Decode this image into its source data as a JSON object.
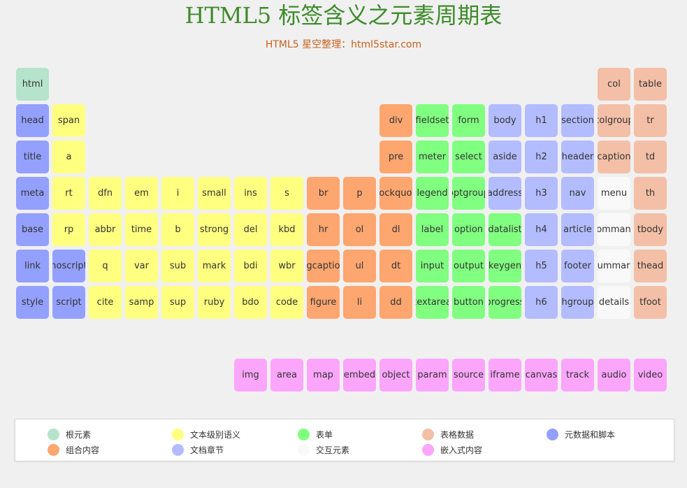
{
  "page": {
    "title": "HTML5 标签含义之元素周期表",
    "subtitle": "HTML5 星空整理：html5star.com"
  },
  "colors": {
    "root": "#b5e3cc",
    "text": "#ffff80",
    "form": "#80ff80",
    "table": "#f3bfa6",
    "meta": "#93a0fd",
    "group": "#fda670",
    "section": "#b3bcfe",
    "interactive": "#f9f9f9",
    "embedded": "#fba5fb"
  },
  "elements": [
    {
      "label": "html",
      "cat": "root",
      "col": 0,
      "row": 0
    },
    {
      "label": "col",
      "cat": "table",
      "col": 16,
      "row": 0
    },
    {
      "label": "table",
      "cat": "table",
      "col": 17,
      "row": 0
    },
    {
      "label": "head",
      "cat": "meta",
      "col": 0,
      "row": 1
    },
    {
      "label": "span",
      "cat": "text",
      "col": 1,
      "row": 1
    },
    {
      "label": "div",
      "cat": "group",
      "col": 10,
      "row": 1
    },
    {
      "label": "fieldset",
      "cat": "form",
      "col": 11,
      "row": 1
    },
    {
      "label": "form",
      "cat": "form",
      "col": 12,
      "row": 1
    },
    {
      "label": "body",
      "cat": "section",
      "col": 13,
      "row": 1
    },
    {
      "label": "h1",
      "cat": "section",
      "col": 14,
      "row": 1
    },
    {
      "label": "section",
      "cat": "section",
      "col": 15,
      "row": 1
    },
    {
      "label": "colgroup",
      "cat": "table",
      "col": 16,
      "row": 1
    },
    {
      "label": "tr",
      "cat": "table",
      "col": 17,
      "row": 1
    },
    {
      "label": "title",
      "cat": "meta",
      "col": 0,
      "row": 2
    },
    {
      "label": "a",
      "cat": "text",
      "col": 1,
      "row": 2
    },
    {
      "label": "pre",
      "cat": "group",
      "col": 10,
      "row": 2
    },
    {
      "label": "meter",
      "cat": "form",
      "col": 11,
      "row": 2
    },
    {
      "label": "select",
      "cat": "form",
      "col": 12,
      "row": 2
    },
    {
      "label": "aside",
      "cat": "section",
      "col": 13,
      "row": 2
    },
    {
      "label": "h2",
      "cat": "section",
      "col": 14,
      "row": 2
    },
    {
      "label": "header",
      "cat": "section",
      "col": 15,
      "row": 2
    },
    {
      "label": "caption",
      "cat": "table",
      "col": 16,
      "row": 2
    },
    {
      "label": "td",
      "cat": "table",
      "col": 17,
      "row": 2
    },
    {
      "label": "meta",
      "cat": "meta",
      "col": 0,
      "row": 3
    },
    {
      "label": "rt",
      "cat": "text",
      "col": 1,
      "row": 3
    },
    {
      "label": "dfn",
      "cat": "text",
      "col": 2,
      "row": 3
    },
    {
      "label": "em",
      "cat": "text",
      "col": 3,
      "row": 3
    },
    {
      "label": "i",
      "cat": "text",
      "col": 4,
      "row": 3
    },
    {
      "label": "small",
      "cat": "text",
      "col": 5,
      "row": 3
    },
    {
      "label": "ins",
      "cat": "text",
      "col": 6,
      "row": 3
    },
    {
      "label": "s",
      "cat": "text",
      "col": 7,
      "row": 3
    },
    {
      "label": "br",
      "cat": "group",
      "col": 8,
      "row": 3
    },
    {
      "label": "p",
      "cat": "group",
      "col": 9,
      "row": 3
    },
    {
      "label": "blockquote",
      "cat": "group",
      "col": 10,
      "row": 3
    },
    {
      "label": "legend",
      "cat": "form",
      "col": 11,
      "row": 3
    },
    {
      "label": "optgroup",
      "cat": "form",
      "col": 12,
      "row": 3
    },
    {
      "label": "address",
      "cat": "section",
      "col": 13,
      "row": 3
    },
    {
      "label": "h3",
      "cat": "section",
      "col": 14,
      "row": 3
    },
    {
      "label": "nav",
      "cat": "section",
      "col": 15,
      "row": 3
    },
    {
      "label": "menu",
      "cat": "interactive",
      "col": 16,
      "row": 3
    },
    {
      "label": "th",
      "cat": "table",
      "col": 17,
      "row": 3
    },
    {
      "label": "base",
      "cat": "meta",
      "col": 0,
      "row": 4
    },
    {
      "label": "rp",
      "cat": "text",
      "col": 1,
      "row": 4
    },
    {
      "label": "abbr",
      "cat": "text",
      "col": 2,
      "row": 4
    },
    {
      "label": "time",
      "cat": "text",
      "col": 3,
      "row": 4
    },
    {
      "label": "b",
      "cat": "text",
      "col": 4,
      "row": 4
    },
    {
      "label": "strong",
      "cat": "text",
      "col": 5,
      "row": 4
    },
    {
      "label": "del",
      "cat": "text",
      "col": 6,
      "row": 4
    },
    {
      "label": "kbd",
      "cat": "text",
      "col": 7,
      "row": 4
    },
    {
      "label": "hr",
      "cat": "group",
      "col": 8,
      "row": 4
    },
    {
      "label": "ol",
      "cat": "group",
      "col": 9,
      "row": 4
    },
    {
      "label": "dl",
      "cat": "group",
      "col": 10,
      "row": 4
    },
    {
      "label": "label",
      "cat": "form",
      "col": 11,
      "row": 4
    },
    {
      "label": "option",
      "cat": "form",
      "col": 12,
      "row": 4
    },
    {
      "label": "datalist",
      "cat": "form",
      "col": 13,
      "row": 4
    },
    {
      "label": "h4",
      "cat": "section",
      "col": 14,
      "row": 4
    },
    {
      "label": "article",
      "cat": "section",
      "col": 15,
      "row": 4
    },
    {
      "label": "command",
      "cat": "interactive",
      "col": 16,
      "row": 4
    },
    {
      "label": "tbody",
      "cat": "table",
      "col": 17,
      "row": 4
    },
    {
      "label": "link",
      "cat": "meta",
      "col": 0,
      "row": 5
    },
    {
      "label": "noscript",
      "cat": "meta",
      "col": 1,
      "row": 5
    },
    {
      "label": "q",
      "cat": "text",
      "col": 2,
      "row": 5
    },
    {
      "label": "var",
      "cat": "text",
      "col": 3,
      "row": 5
    },
    {
      "label": "sub",
      "cat": "text",
      "col": 4,
      "row": 5
    },
    {
      "label": "mark",
      "cat": "text",
      "col": 5,
      "row": 5
    },
    {
      "label": "bdi",
      "cat": "text",
      "col": 6,
      "row": 5
    },
    {
      "label": "wbr",
      "cat": "text",
      "col": 7,
      "row": 5
    },
    {
      "label": "figcaption",
      "cat": "group",
      "col": 8,
      "row": 5
    },
    {
      "label": "ul",
      "cat": "group",
      "col": 9,
      "row": 5
    },
    {
      "label": "dt",
      "cat": "group",
      "col": 10,
      "row": 5
    },
    {
      "label": "input",
      "cat": "form",
      "col": 11,
      "row": 5
    },
    {
      "label": "output",
      "cat": "form",
      "col": 12,
      "row": 5
    },
    {
      "label": "keygen",
      "cat": "form",
      "col": 13,
      "row": 5
    },
    {
      "label": "h5",
      "cat": "section",
      "col": 14,
      "row": 5
    },
    {
      "label": "footer",
      "cat": "section",
      "col": 15,
      "row": 5
    },
    {
      "label": "summary",
      "cat": "interactive",
      "col": 16,
      "row": 5
    },
    {
      "label": "thead",
      "cat": "table",
      "col": 17,
      "row": 5
    },
    {
      "label": "style",
      "cat": "meta",
      "col": 0,
      "row": 6
    },
    {
      "label": "script",
      "cat": "meta",
      "col": 1,
      "row": 6
    },
    {
      "label": "cite",
      "cat": "text",
      "col": 2,
      "row": 6
    },
    {
      "label": "samp",
      "cat": "text",
      "col": 3,
      "row": 6
    },
    {
      "label": "sup",
      "cat": "text",
      "col": 4,
      "row": 6
    },
    {
      "label": "ruby",
      "cat": "text",
      "col": 5,
      "row": 6
    },
    {
      "label": "bdo",
      "cat": "text",
      "col": 6,
      "row": 6
    },
    {
      "label": "code",
      "cat": "text",
      "col": 7,
      "row": 6
    },
    {
      "label": "figure",
      "cat": "group",
      "col": 8,
      "row": 6
    },
    {
      "label": "li",
      "cat": "group",
      "col": 9,
      "row": 6
    },
    {
      "label": "dd",
      "cat": "group",
      "col": 10,
      "row": 6
    },
    {
      "label": "textarea",
      "cat": "form",
      "col": 11,
      "row": 6
    },
    {
      "label": "button",
      "cat": "form",
      "col": 12,
      "row": 6
    },
    {
      "label": "progress",
      "cat": "form",
      "col": 13,
      "row": 6
    },
    {
      "label": "h6",
      "cat": "section",
      "col": 14,
      "row": 6
    },
    {
      "label": "hgroup",
      "cat": "section",
      "col": 15,
      "row": 6
    },
    {
      "label": "details",
      "cat": "interactive",
      "col": 16,
      "row": 6
    },
    {
      "label": "tfoot",
      "cat": "table",
      "col": 17,
      "row": 6
    },
    {
      "label": "img",
      "cat": "embedded",
      "col": 6,
      "row": 8
    },
    {
      "label": "area",
      "cat": "embedded",
      "col": 7,
      "row": 8
    },
    {
      "label": "map",
      "cat": "embedded",
      "col": 8,
      "row": 8
    },
    {
      "label": "embed",
      "cat": "embedded",
      "col": 9,
      "row": 8
    },
    {
      "label": "object",
      "cat": "embedded",
      "col": 10,
      "row": 8
    },
    {
      "label": "param",
      "cat": "embedded",
      "col": 11,
      "row": 8
    },
    {
      "label": "source",
      "cat": "embedded",
      "col": 12,
      "row": 8
    },
    {
      "label": "iframe",
      "cat": "embedded",
      "col": 13,
      "row": 8
    },
    {
      "label": "canvas",
      "cat": "embedded",
      "col": 14,
      "row": 8
    },
    {
      "label": "track",
      "cat": "embedded",
      "col": 15,
      "row": 8
    },
    {
      "label": "audio",
      "cat": "embedded",
      "col": 16,
      "row": 8
    },
    {
      "label": "video",
      "cat": "embedded",
      "col": 17,
      "row": 8
    }
  ],
  "legend": [
    {
      "label": "根元素",
      "cat": "root"
    },
    {
      "label": "文本级别语义",
      "cat": "text"
    },
    {
      "label": "表单",
      "cat": "form"
    },
    {
      "label": "表格数据",
      "cat": "table"
    },
    {
      "label": "元数据和脚本",
      "cat": "meta"
    },
    {
      "label": "组合内容",
      "cat": "group"
    },
    {
      "label": "文档章节",
      "cat": "section"
    },
    {
      "label": "交互元素",
      "cat": "interactive"
    },
    {
      "label": "嵌入式内容",
      "cat": "embedded"
    }
  ]
}
